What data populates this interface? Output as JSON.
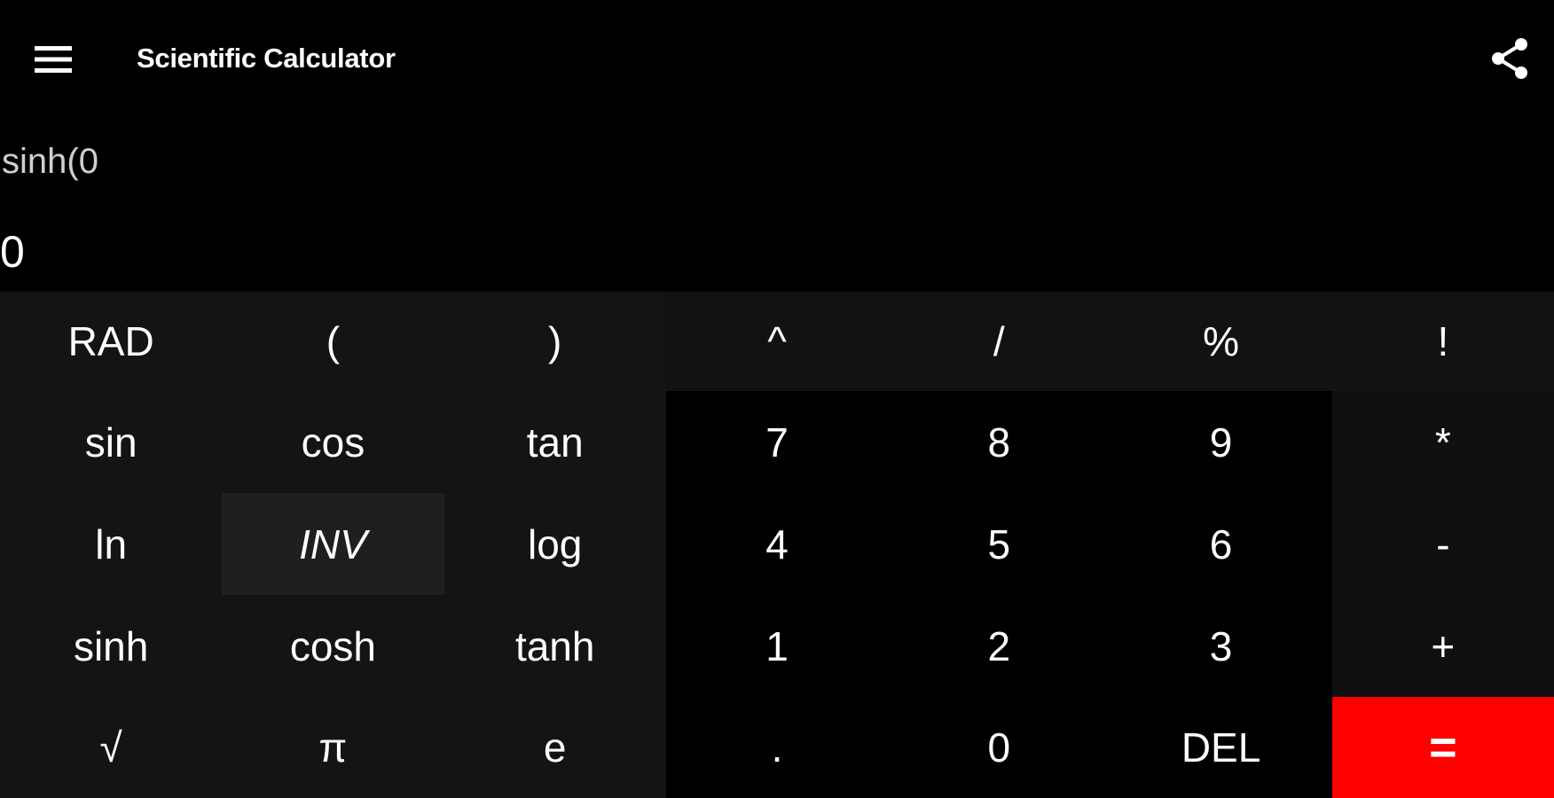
{
  "app_bar": {
    "title": "Scientific Calculator",
    "menu_icon": "menu-icon",
    "share_icon": "share-icon"
  },
  "display": {
    "expression": "sinh(0",
    "result": "0"
  },
  "keypad": {
    "rows": [
      [
        "RAD",
        "(",
        ")",
        "^",
        "/",
        "%",
        "!"
      ],
      [
        "sin",
        "cos",
        "tan",
        "7",
        "8",
        "9",
        "*"
      ],
      [
        "ln",
        "INV",
        "log",
        "4",
        "5",
        "6",
        "-"
      ],
      [
        "sinh",
        "cosh",
        "tanh",
        "1",
        "2",
        "3",
        "+"
      ],
      [
        "√",
        "π",
        "e",
        ".",
        "0",
        "DEL",
        "="
      ]
    ]
  },
  "colors": {
    "background": "#000000",
    "function_key": "#141414",
    "inv_key_active": "#1f1f1f",
    "equals_key": "#ff0000",
    "text": "#ffffff"
  }
}
